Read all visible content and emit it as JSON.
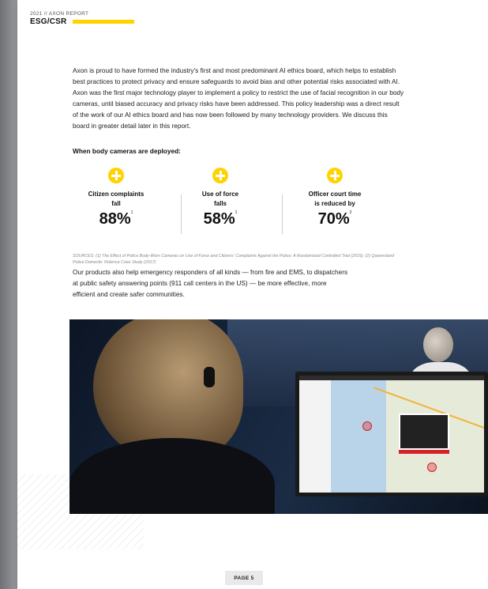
{
  "header": {
    "report_line": "2021 // AXON REPORT",
    "title": "ESG/CSR"
  },
  "intro": "Axon is proud to have formed the industry's first and most predominant AI ethics board, which helps to establish best practices to protect privacy and ensure safeguards to avoid bias and other potential risks associated with AI. Axon was the first major technology player to implement a policy to restrict the use of facial recognition in our body cameras, until biased accuracy and privacy risks have been addressed. This policy leadership was a direct result of the work of our AI ethics board and has now been followed by many technology providers. We discuss this board in greater detail later in this report.",
  "subheading": "When body cameras are deployed:",
  "stats": [
    {
      "label_line1": "Citizen complaints",
      "label_line2": "fall",
      "value": "88%",
      "note": "1"
    },
    {
      "label_line1": "Use of force",
      "label_line2": "falls",
      "value": "58%",
      "note": "1"
    },
    {
      "label_line1": "Officer court time",
      "label_line2": "is reduced by",
      "value": "70%",
      "note": "2"
    }
  ],
  "sources": "SOURCES: (1) The Effect of Police Body-Worn Cameras on Use of Force and Citizens' Complaints Against the Police: A Randomized Controlled Trial (2015); (2) Queensland Police Domestic Violence Case Study (2017)",
  "body2": "Our products also help emergency responders of all kinds — from fire and EMS, to dispatchers at public safety answering points (911 call centers in the US) — be more effective, more efficient and create safer communities.",
  "footer": {
    "page": "PAGE 5"
  },
  "colors": {
    "accent": "#ffd200",
    "text": "#222222"
  }
}
